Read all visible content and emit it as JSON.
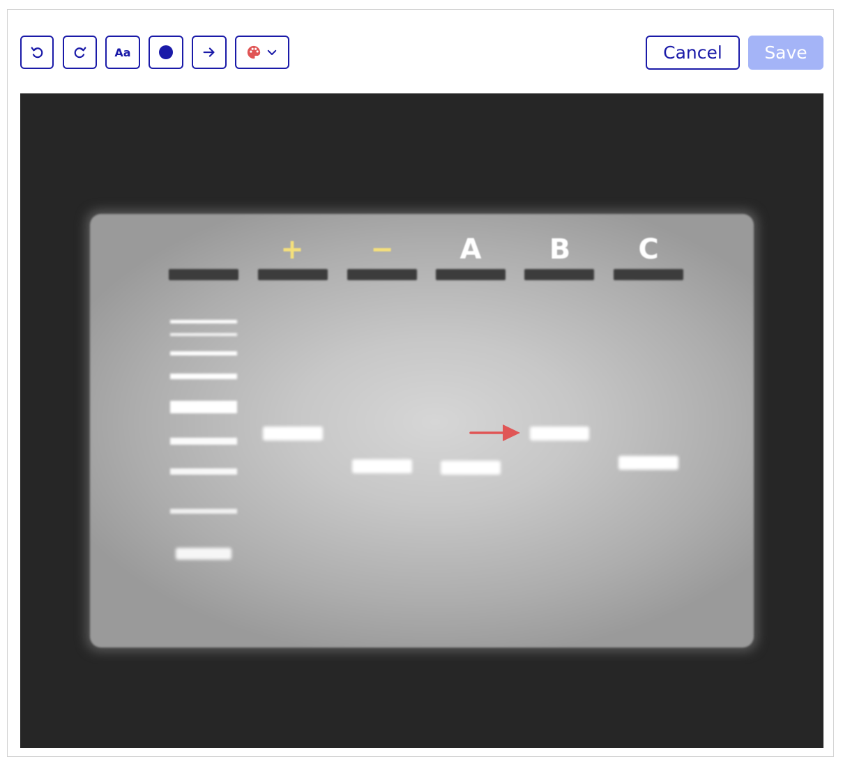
{
  "toolbar": {
    "tools": [
      {
        "name": "undo",
        "icon": "undo-icon"
      },
      {
        "name": "redo",
        "icon": "redo-icon"
      },
      {
        "name": "text",
        "icon": "text-tool-icon",
        "label": "Aa"
      },
      {
        "name": "circle",
        "icon": "filled-circle-icon"
      },
      {
        "name": "arrow",
        "icon": "arrow-right-icon"
      },
      {
        "name": "color",
        "icon": "palette-icon",
        "dropdown_icon": "chevron-down-icon"
      }
    ],
    "cancel_label": "Cancel",
    "save_label": "Save"
  },
  "colors": {
    "accent": "#1a1aa8",
    "save_disabled": "#a4b4f7",
    "canvas_background": "#262626",
    "palette_icon": "#e05555",
    "annotation_arrow": "#e05555",
    "control_lane_labels": "#f5e07a",
    "sample_lane_labels": "#ffffff"
  },
  "image": {
    "lane_labels": [
      "+",
      "−",
      "A",
      "B",
      "C"
    ]
  }
}
